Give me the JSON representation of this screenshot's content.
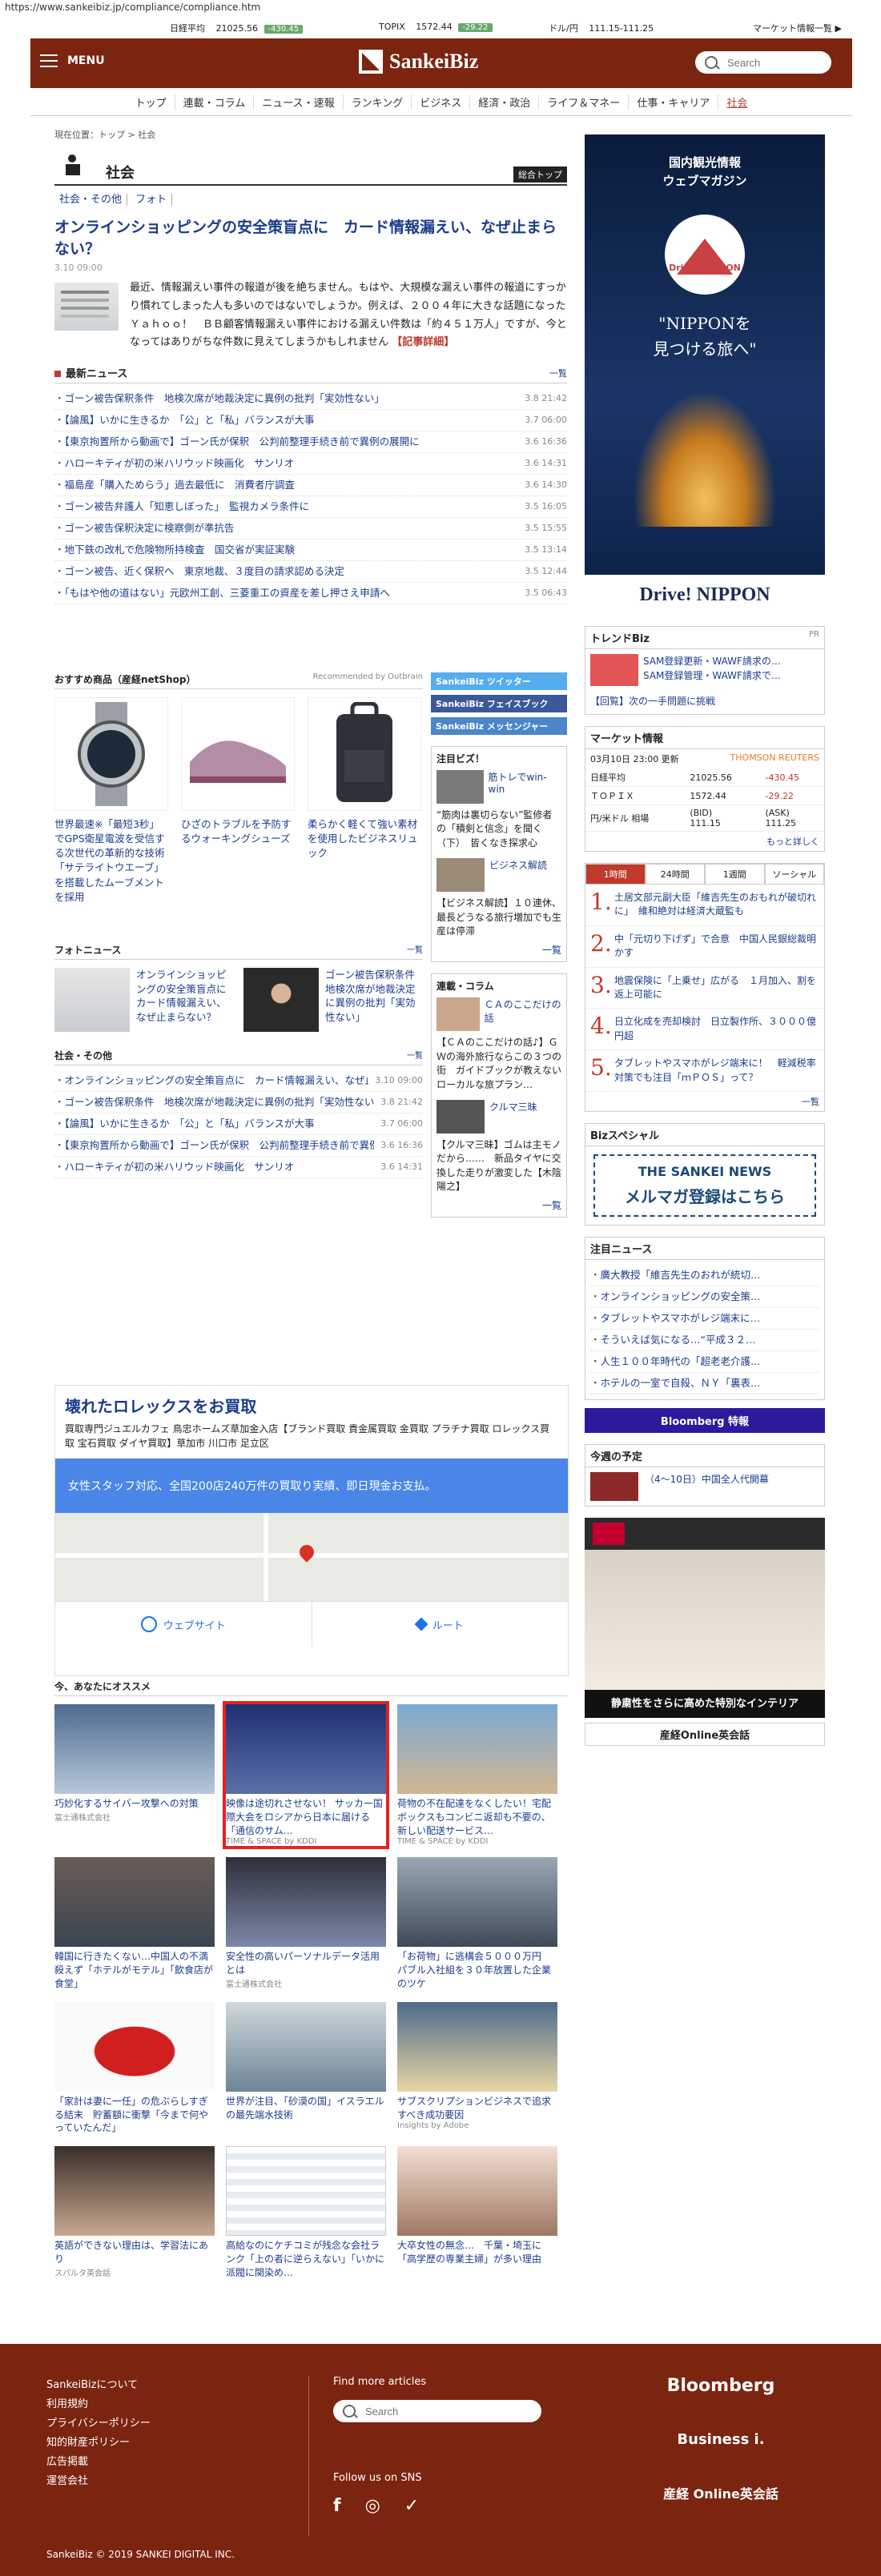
{
  "url": "https://www.sankeibiz.jp/compliance/compliance.htm",
  "market_bar": {
    "nikkei_label": "日経平均",
    "nikkei_value": "21025.56",
    "nikkei_change": "-430.45",
    "topix_label": "TOPIX",
    "topix_value": "1572.44",
    "topix_change": "-29.22",
    "usd_label": "ドル/円",
    "usd_value": "111.15-111.25",
    "market_link": "マーケット情報一覧 ▶"
  },
  "header": {
    "menu_label": "MENU",
    "logo": "SankeiBiz",
    "search_placeholder": "Search"
  },
  "nav": [
    "トップ",
    "連載・コラム",
    "ニュース・速報",
    "ランキング",
    "ビジネス",
    "経済・政治",
    "ライフ＆マネー",
    "仕事・キャリア",
    "社会"
  ],
  "breadcrumb": "現在位置：トップ > 社会",
  "section": {
    "title": "社会",
    "top_btn": "総合トップ",
    "tabs": [
      "社会・その他",
      "フォト"
    ]
  },
  "lead": {
    "title": "オンラインショッピングの安全策盲点に　カード情報漏えい、なぜ止まらない？",
    "date": "3.10 09:00",
    "body": "最近、情報漏えい事件の報道が後を絶ちません。もはや、大規模な漏えい事件の報道にすっかり慣れてしまった人も多いのではないでしょうか。例えば、２００４年に大きな話題になったＹａｈｏｏ！　ＢＢ顧客情報漏えい事件における漏えい件数は「約４５１万人」ですが、今となってはありがちな件数に見えてしまうかもしれません",
    "more": "【記事詳細】"
  },
  "latest_news": {
    "title": "最新ニュース",
    "more": "一覧",
    "items": [
      {
        "t": "ゴーン被告保釈条件　地検次席が地裁決定に異例の批判「実効性ない」",
        "d": "3.8 21:42"
      },
      {
        "t": "【論風】いかに生きるか　「公」と「私」バランスが大事",
        "d": "3.7 06:00"
      },
      {
        "t": "【東京拘置所から動画で】ゴーン氏が保釈　公判前整理手続き前で異例の展開に",
        "d": "3.6 16:36"
      },
      {
        "t": "ハローキティが初の米ハリウッド映画化　サンリオ",
        "d": "3.6 14:31"
      },
      {
        "t": "福島産「購入ためらう」過去最低に　消費者庁調査",
        "d": "3.6 14:30"
      },
      {
        "t": "ゴーン被告弁護人「知恵しぼった」　監視カメラ条件に",
        "d": "3.5 16:05"
      },
      {
        "t": "ゴーン被告保釈決定に検察側が準抗告",
        "d": "3.5 15:55"
      },
      {
        "t": "地下鉄の改札で危険物所持検査　国交省が実証実験",
        "d": "3.5 13:14"
      },
      {
        "t": "ゴーン被告、近く保釈へ　東京地裁、３度目の請求認める決定",
        "d": "3.5 12:44"
      },
      {
        "t": "「もはや他の道はない」元欧州工創、三菱重工の資産を差し押さえ申請へ",
        "d": "3.5 06:43"
      }
    ]
  },
  "products": {
    "title": "おすすめ商品（産経netShop）",
    "rec": "Recommended by Outbrain",
    "items": [
      "世界最速※「最短3秒」でGPS衛星電波を受信する次世代の革新的な技術「サテライトウエーブ」を搭載したムーブメントを採用",
      "ひざのトラブルを予防するウォーキングシューズ",
      "柔らかく軽くて強い素材を使用したビジネスリュック"
    ]
  },
  "social": {
    "twitter": "SankeiBiz ツイッター",
    "facebook": "SankeiBiz フェイスブック",
    "messenger": "SankeiBiz メッセンジャー"
  },
  "biz_pickup": {
    "title": "注目ビズ！",
    "items": [
      "筋トレでwin-win",
      "“筋肉は裏切らない”監修者の「積剣と信念」を聞く（下）　皆くなき探求心",
      "ビジネス解読",
      "【ビジネス解読】１０連休、最長どうなる旅行増加でも生産は停滞"
    ],
    "more": "一覧"
  },
  "column": {
    "title": "連載・コラム",
    "items": [
      "ＣＡのここだけの話",
      "【ＣＡのここだけの話♪】ＧＷの海外旅行ならこの３つの街　ガイドブックが教えないローカルな旅プラン…",
      "クルマ三昧",
      "【クルマ三昧】ゴムは主モノだから……　新品タイヤに交換した走りが激変した【木陰陽之】"
    ],
    "more": "一覧"
  },
  "photo_news": {
    "title": "フォトニュース",
    "more": "一覧",
    "items": [
      "オンラインショッピングの安全策盲点に　カード情報漏えい、なぜ止まらない？",
      "ゴーン被告保釈条件　地検次席が地裁決定に異例の批判「実効性ない」"
    ]
  },
  "social_news": {
    "title": "社会・その他",
    "more": "一覧",
    "items": [
      {
        "t": "オンラインショッピングの安全策盲点に　カード情報漏えい、なぜ止まらない？",
        "d": "3.10 09:00"
      },
      {
        "t": "ゴーン被告保釈条件　地検次席が地裁決定に異例の批判「実効性ない」",
        "d": "3.8 21:42"
      },
      {
        "t": "【論風】いかに生きるか　「公」と「私」バランスが大事",
        "d": "3.7 06:00"
      },
      {
        "t": "【東京拘置所から動画で】ゴーン氏が保釈　公判前整理手続き前で異例の展開に",
        "d": "3.6 16:36"
      },
      {
        "t": "ハローキティが初の米ハリウッド映画化　サンリオ",
        "d": "3.6 14:31"
      }
    ]
  },
  "map_ad": {
    "title": "壊れたロレックスをお買取",
    "desc": "買取専門ジュエルカフェ 鳥忠ホームズ草加金入店【ブランド買取 貴金属買取 金買取 プラチナ買取 ロレックス買取 宝石買取 ダイヤ買取】草加市 川口市 足立区",
    "banner": "女性スタッフ対応、全国200店240万件の買取り実績、即日現金お支払。",
    "website": "ウェブサイト",
    "route": "ルート"
  },
  "osusume": {
    "title": "今、あなたにオススメ",
    "items": [
      {
        "cap": "巧妙化するサイバー攻撃への対策",
        "src": "富士通株式会社"
      },
      {
        "cap": "映像は途切れさせない！ サッカー国際大会をロシアから日本に届ける「通信のサム…",
        "src": "TIME & SPACE by KDDI"
      },
      {
        "cap": "荷物の不在配達をなくしたい！宅配ボックスもコンビニ返却も不要の、新しい配送サービス…",
        "src": "TIME & SPACE by KDDI"
      },
      {
        "cap": "韓国に行きたくない…中国人の不満殺えず「ホテルがモテル」「飲食店が食堂」",
        "src": ""
      },
      {
        "cap": "安全性の高いパーソナルデータ活用とは",
        "src": "富士通株式会社"
      },
      {
        "cap": "「お荷物」に逃構会５０００万円　パブル入社組を３０年放置した企業のツケ",
        "src": ""
      },
      {
        "cap": "「家計は妻に一任」の危ぶらしすぎる結末　貯蓄額に衝撃「今まで何やっていたんだ」",
        "src": ""
      },
      {
        "cap": "世界が注目、「砂漠の国」イスラエルの最先端水技術",
        "src": ""
      },
      {
        "cap": "サブスクリプションビジネスで追求すべき成功要因",
        "src": "Insights by Adobe"
      },
      {
        "cap": "英語ができない理由は、学習法にあり",
        "src": "スパルタ英会話"
      },
      {
        "cap": "高給なのにケチコミが残念な会社ランク「上の者に逆らえない」「いかに派閥に関染め…",
        "src": ""
      },
      {
        "cap": "大卒女性の無念…　千葉・埼玉に「高学歴の専業主婦」が多い理由",
        "src": ""
      }
    ]
  },
  "right": {
    "ad_title": "国内観光情報\nウェブマガジン",
    "ad_logo": "Drive! NIPPON",
    "ad_slogan": "\"NIPPONを\n見つける旅へ\"",
    "ad_brand": "Drive! NIPPON",
    "trend": {
      "title": "トレンドBiz",
      "pr": "PR",
      "items": [
        "SAM登録更新・WAWF請求の…",
        "SAM登録管理・WAWF請求で…",
        "【回覧】次の一手問題に挑戦"
      ]
    },
    "market": {
      "title": "マーケット情報",
      "time": "03月10日 23:00 更新",
      "source": "THOMSON REUTERS",
      "rows": [
        {
          "label": "日経平均",
          "value": "21025.56",
          "change": "-430.45"
        },
        {
          "label": "ＴＯＰＩＸ",
          "value": "1572.44",
          "change": "-29.22"
        },
        {
          "label": "円/米ドル 相場",
          "value": "111.15",
          "change": "111.25"
        }
      ],
      "bid": "(BID)",
      "ask": "(ASK)",
      "more": "もっと詳しく"
    },
    "rank": {
      "tabs": [
        "1時間",
        "24時間",
        "1週間",
        "ソーシャル"
      ],
      "items": [
        "土居文部元副大臣「維吉先生のおもれが破切れに」　維和絶対は経済大蔵監も",
        "中「元切り下げず」で合意　中国人民銀総裁明かす",
        "地震保険に「上乗せ」広がる　１月加入、割を返上可能に",
        "日立化成を売却検討　日立製作所、３０００億円超",
        "タブレットやスマホがレジ端末に！　軽減税率対策でも注目「ｍＰＯＳ」って？"
      ],
      "more": "一覧"
    },
    "biz_special": "Bizスペシャル",
    "sankei_news": "THE SANKEI NEWS",
    "mailmag": "メルマガ登録はこちら",
    "featured": {
      "title": "注目ニュース",
      "items": [
        "廣大教授「維吉先生のおれが統切…",
        "オンラインショッピングの安全策…",
        "タブレットやスマホがレジ端末に…",
        "そういえば気になる…“平成３２…",
        "人生１００年時代の「超老老介護…",
        "ホテルの一室で自殺、ＮＹ「裏表…"
      ]
    },
    "bloomberg": "Bloomberg 特報",
    "schedule": {
      "title": "今週の予定",
      "item": "（4～10日）中国全人代開幕"
    },
    "nissan_caption": "静粛性をさらに高めた特別なインテリア",
    "eikaiwa": "産経Online英会話"
  },
  "footer": {
    "links": [
      "SankeiBizについて",
      "利用規約",
      "プライバシーポリシー",
      "知的財産ポリシー",
      "広告掲載",
      "運営会社"
    ],
    "find": "Find more articles",
    "search_placeholder": "Search",
    "sns": "Follow us on SNS",
    "copyright": "SankeiBiz © 2019 SANKEI DIGITAL INC.",
    "brands": [
      "Bloomberg",
      "Business i.",
      "産経 Online英会話"
    ]
  },
  "colors": {
    "brand": "#7b2410",
    "link": "#1a3c8c",
    "accent": "#c0392b"
  }
}
